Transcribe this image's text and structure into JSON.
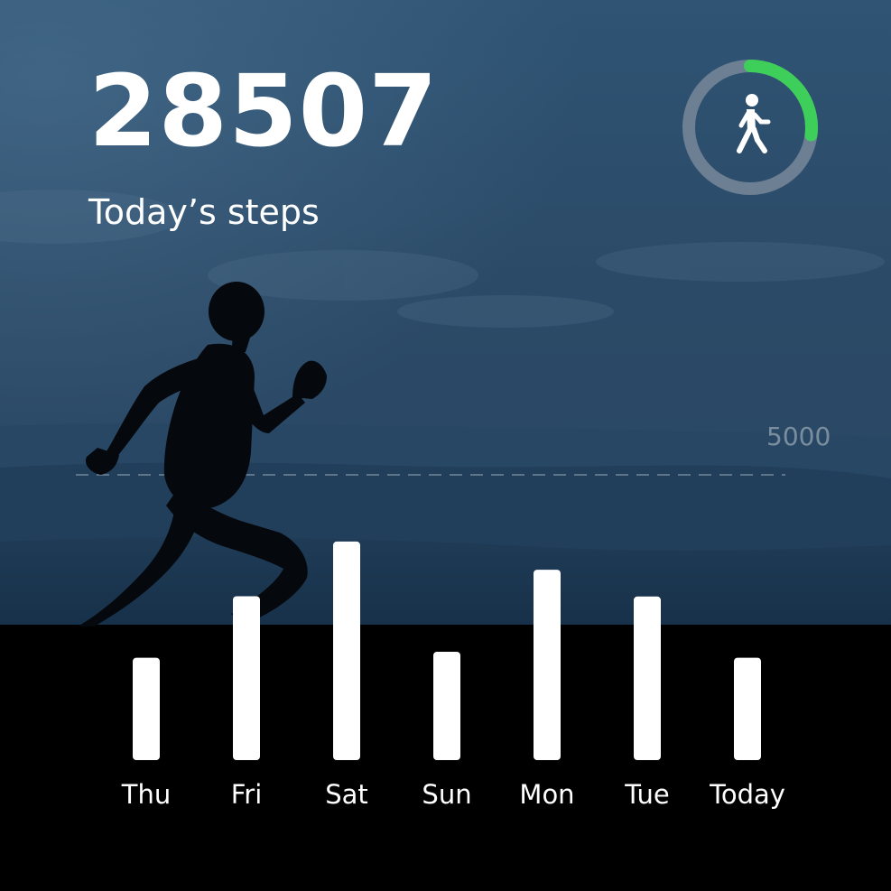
{
  "header": {
    "steps_count": "28507",
    "steps_label": "Today’s steps"
  },
  "progress_ring": {
    "icon": "walking-person-icon",
    "progress": 0.27,
    "track_color": "#6c7f93",
    "fill_color": "#3ecf5a"
  },
  "goal": {
    "label": "5000",
    "value": 5000
  },
  "chart_data": {
    "type": "bar",
    "categories": [
      "Thu",
      "Fri",
      "Sat",
      "Sun",
      "Mon",
      "Tue",
      "Today"
    ],
    "values": [
      3780,
      6050,
      8070,
      4000,
      7030,
      6040,
      3780
    ],
    "ylim": [
      0,
      8200
    ],
    "bar_color": "#ffffff"
  }
}
